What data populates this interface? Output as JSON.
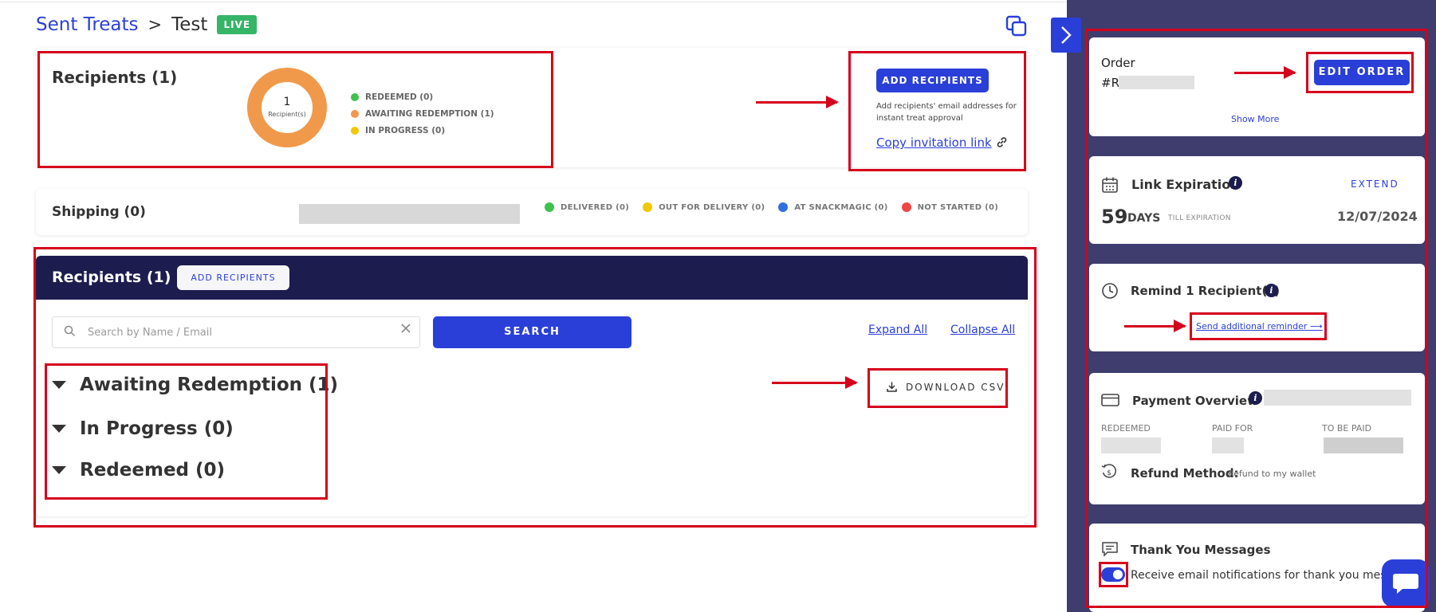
{
  "header": {
    "breadcrumb_parent": "Sent Treats",
    "breadcrumb_sep": ">",
    "breadcrumb_current": "Test",
    "status_badge": "LIVE"
  },
  "summary": {
    "title": "Recipients (1)",
    "donut_count": "1",
    "donut_caption": "Recipient(s)",
    "legend": [
      {
        "label": "REDEEMED (0)",
        "color": "#3ec24f",
        "value": 0
      },
      {
        "label": "AWAITING REDEMPTION (1)",
        "color": "#f0994a",
        "value": 1
      },
      {
        "label": "IN PROGRESS (0)",
        "color": "#f2c600",
        "value": 0
      }
    ],
    "add_button": "ADD RECIPIENTS",
    "add_hint": "Add recipients' email addresses for instant treat approval",
    "copy_link": "Copy invitation link"
  },
  "shipping": {
    "title": "Shipping (0)",
    "legend": [
      {
        "label": "DELIVERED (0)",
        "color": "#3ec24f"
      },
      {
        "label": "OUT FOR DELIVERY (0)",
        "color": "#f2c600"
      },
      {
        "label": "AT SNACKMAGIC (0)",
        "color": "#2f6fe0"
      },
      {
        "label": "NOT STARTED (0)",
        "color": "#f04646"
      }
    ]
  },
  "recipients_table": {
    "title": "Recipients (1)",
    "add_button": "ADD RECIPIENTS",
    "search_placeholder": "Search by Name / Email",
    "search_button": "SEARCH",
    "expand_all": "Expand All",
    "collapse_all": "Collapse All",
    "download_csv": "DOWNLOAD CSV",
    "groups": [
      {
        "label": "Awaiting Redemption (1)"
      },
      {
        "label": "In Progress (0)"
      },
      {
        "label": "Redeemed (0)"
      }
    ]
  },
  "sidebar": {
    "order": {
      "label": "Order",
      "id_prefix": "#R",
      "edit_button": "EDIT ORDER",
      "show_more": "Show More"
    },
    "link_expiration": {
      "title": "Link Expiration",
      "extend": "EXTEND",
      "days": "59",
      "days_unit": "DAYS",
      "days_caption": "TILL EXPIRATION",
      "date": "12/07/2024"
    },
    "remind": {
      "title": "Remind 1 Recipient(s)",
      "link": "Send additional reminder ⟶"
    },
    "payment": {
      "title": "Payment Overview",
      "columns": [
        "REDEEMED",
        "PAID FOR",
        "TO BE PAID"
      ],
      "refund_label": "Refund Method:",
      "refund_value": "Refund to my wallet"
    },
    "thank_you": {
      "title": "Thank You Messages",
      "toggle_label": "Receive email notifications for thank you messages",
      "toggle_on": true
    }
  },
  "colors": {
    "brand_blue": "#2a3fd8",
    "navy": "#1d1c4f",
    "sidebar_bg": "#3e3d6e",
    "live_green": "#34b567",
    "annotation_red": "#d5001c"
  }
}
